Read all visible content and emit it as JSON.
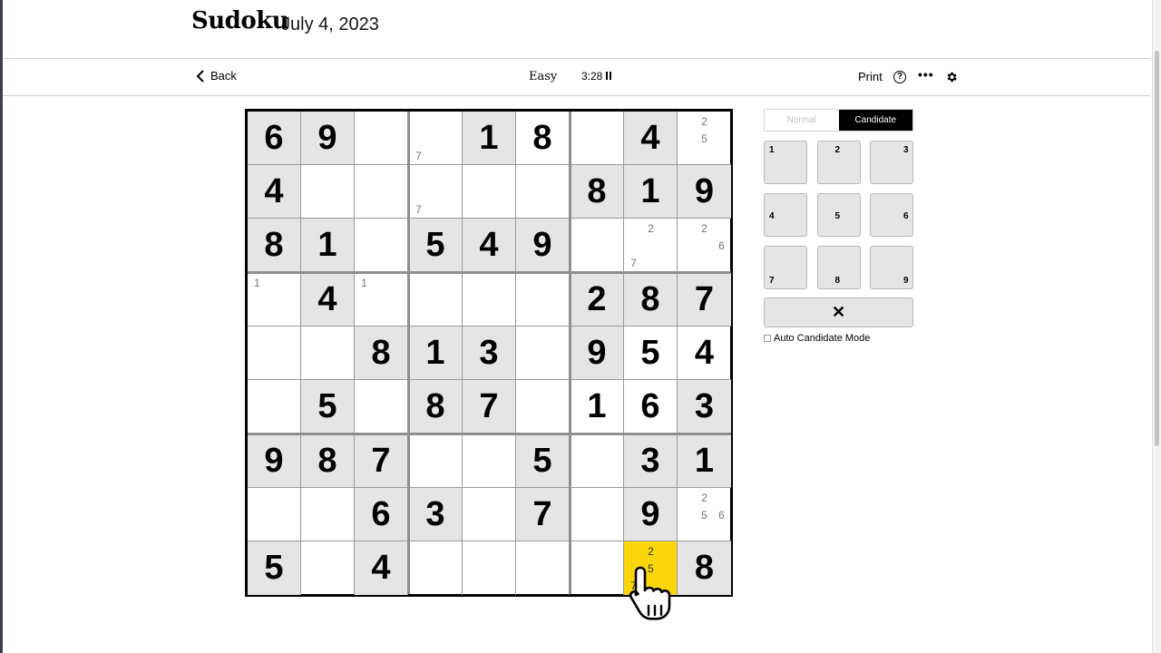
{
  "header": {
    "logo": "Sudoku",
    "date": "July 4, 2023"
  },
  "toolbar": {
    "back_label": "Back",
    "difficulty": "Easy",
    "timer": "3:28",
    "print_label": "Print",
    "help_glyph": "?",
    "more_glyph": "•••"
  },
  "icons": {
    "back": "chevron-left-icon",
    "pause": "pause-icon",
    "help": "question-circle-icon",
    "more": "ellipsis-icon",
    "settings": "gear-icon",
    "erase": "x-icon",
    "cursor": "hand-pointer-icon"
  },
  "colors": {
    "given_bg": "#e5e5e5",
    "selected_bg": "#fbd609",
    "candidate_mode_bg": "#000000"
  },
  "board": {
    "selected": [
      8,
      7
    ],
    "cells": [
      [
        {
          "v": "6",
          "g": true
        },
        {
          "v": "9",
          "g": true
        },
        {
          "v": ""
        },
        {
          "v": "",
          "c": [
            "7"
          ]
        },
        {
          "v": "1",
          "g": true
        },
        {
          "v": "8"
        },
        {
          "v": ""
        },
        {
          "v": "4",
          "g": true
        },
        {
          "v": "",
          "c": [
            "2",
            "5"
          ]
        }
      ],
      [
        {
          "v": "4",
          "g": true
        },
        {
          "v": ""
        },
        {
          "v": ""
        },
        {
          "v": "",
          "c": [
            "7"
          ]
        },
        {
          "v": ""
        },
        {
          "v": ""
        },
        {
          "v": "8",
          "g": true
        },
        {
          "v": "1",
          "g": true
        },
        {
          "v": "9",
          "g": true
        }
      ],
      [
        {
          "v": "8",
          "g": true
        },
        {
          "v": "1",
          "g": true
        },
        {
          "v": ""
        },
        {
          "v": "5",
          "g": true
        },
        {
          "v": "4",
          "g": true
        },
        {
          "v": "9",
          "g": true
        },
        {
          "v": ""
        },
        {
          "v": "",
          "c": [
            "2",
            "7"
          ]
        },
        {
          "v": "",
          "c": [
            "2",
            "6"
          ]
        }
      ],
      [
        {
          "v": "",
          "c": [
            "1"
          ]
        },
        {
          "v": "4",
          "g": true
        },
        {
          "v": "",
          "c": [
            "1"
          ]
        },
        {
          "v": ""
        },
        {
          "v": ""
        },
        {
          "v": ""
        },
        {
          "v": "2",
          "g": true
        },
        {
          "v": "8",
          "g": true
        },
        {
          "v": "7",
          "g": true
        }
      ],
      [
        {
          "v": ""
        },
        {
          "v": ""
        },
        {
          "v": "8",
          "g": true
        },
        {
          "v": "1",
          "g": true
        },
        {
          "v": "3",
          "g": true
        },
        {
          "v": ""
        },
        {
          "v": "9",
          "g": true
        },
        {
          "v": "5"
        },
        {
          "v": "4"
        }
      ],
      [
        {
          "v": ""
        },
        {
          "v": "5",
          "g": true
        },
        {
          "v": ""
        },
        {
          "v": "8",
          "g": true
        },
        {
          "v": "7",
          "g": true
        },
        {
          "v": ""
        },
        {
          "v": "1"
        },
        {
          "v": "6"
        },
        {
          "v": "3",
          "g": true
        }
      ],
      [
        {
          "v": "9",
          "g": true
        },
        {
          "v": "8",
          "g": true
        },
        {
          "v": "7",
          "g": true
        },
        {
          "v": ""
        },
        {
          "v": ""
        },
        {
          "v": "5",
          "g": true
        },
        {
          "v": ""
        },
        {
          "v": "3",
          "g": true
        },
        {
          "v": "1",
          "g": true
        }
      ],
      [
        {
          "v": ""
        },
        {
          "v": ""
        },
        {
          "v": "6",
          "g": true
        },
        {
          "v": "3",
          "g": true
        },
        {
          "v": ""
        },
        {
          "v": "7",
          "g": true
        },
        {
          "v": ""
        },
        {
          "v": "9",
          "g": true
        },
        {
          "v": "",
          "c": [
            "2",
            "5",
            "6"
          ]
        }
      ],
      [
        {
          "v": "5",
          "g": true
        },
        {
          "v": ""
        },
        {
          "v": "4",
          "g": true
        },
        {
          "v": ""
        },
        {
          "v": ""
        },
        {
          "v": ""
        },
        {
          "v": ""
        },
        {
          "v": "",
          "c": [
            "2",
            "5",
            "7"
          ]
        },
        {
          "v": "8",
          "g": true
        }
      ]
    ]
  },
  "controls": {
    "mode_normal": "Normal",
    "mode_candidate": "Candidate",
    "keys": [
      "1",
      "2",
      "3",
      "4",
      "5",
      "6",
      "7",
      "8",
      "9"
    ],
    "erase_glyph": "✕",
    "auto_candidate_label": "Auto Candidate Mode"
  }
}
